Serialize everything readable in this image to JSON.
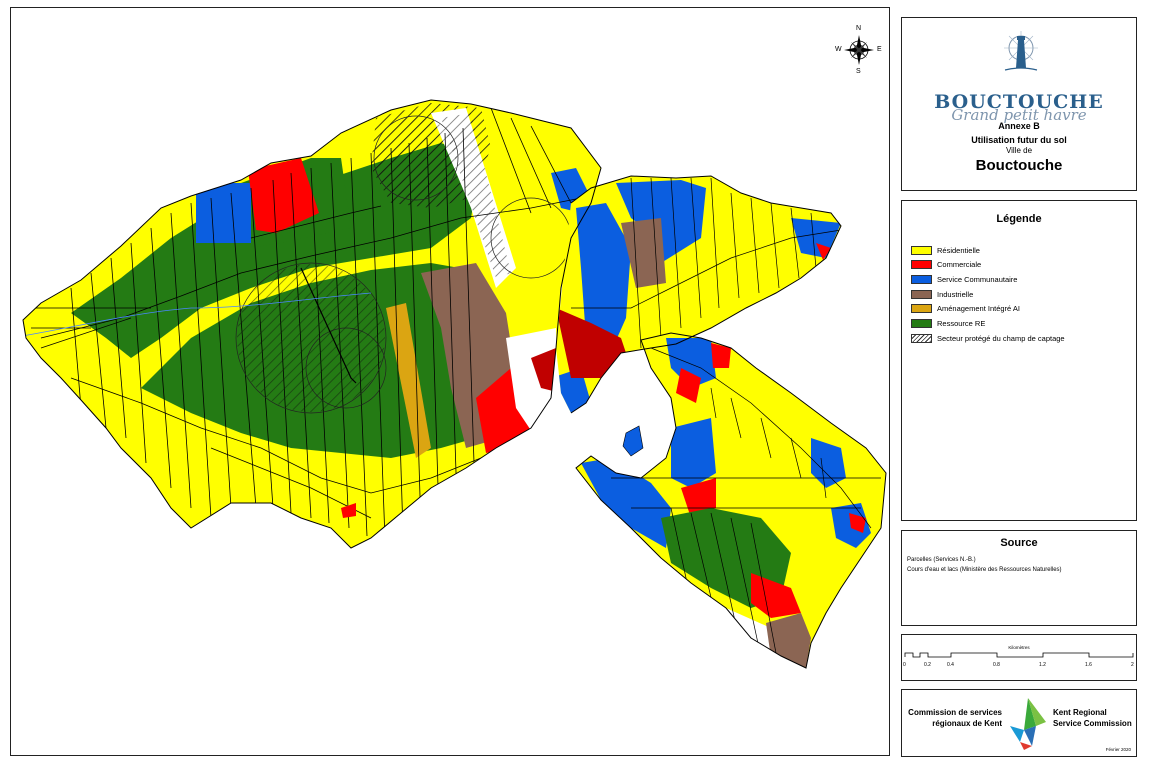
{
  "title_box": {
    "brand": "BOUCTOUCHE",
    "tagline": "Grand petit havre",
    "annex": "Annexe B",
    "subtitle": "Utilisation futur du sol",
    "ville_de": "Ville de",
    "town": "Bouctouche"
  },
  "compass": {
    "n": "N",
    "s": "S",
    "e": "E",
    "w": "W"
  },
  "legend": {
    "title": "Légende",
    "items": [
      {
        "label": "Résidentielle",
        "color": "#ffff00"
      },
      {
        "label": "Commerciale",
        "color": "#ff0000"
      },
      {
        "label": "Service Communautaire",
        "color": "#0b5ee0"
      },
      {
        "label": "Industrielle",
        "color": "#8b6553"
      },
      {
        "label": "Aménagement Intégré AI",
        "color": "#dba512"
      },
      {
        "label": "Ressource RE",
        "color": "#247b14"
      },
      {
        "label": "Secteur protégé du champ de captage",
        "color": "hatch"
      }
    ]
  },
  "source": {
    "title": "Source",
    "lines": [
      "Parcelles (Services N.-B.)",
      "Cours d'eau et lacs (Ministère des Ressources Naturelles)"
    ]
  },
  "scale": {
    "unit": "Kilomètres",
    "ticks": [
      "0",
      "0.2",
      "0.4",
      "0.8",
      "1.2",
      "1.6",
      "2"
    ]
  },
  "org": {
    "fr_line1": "Commission de services",
    "fr_line2": "régionaux de Kent",
    "en_line1": "Kent Regional",
    "en_line2": "Service Commission",
    "date": "Février 2020"
  }
}
